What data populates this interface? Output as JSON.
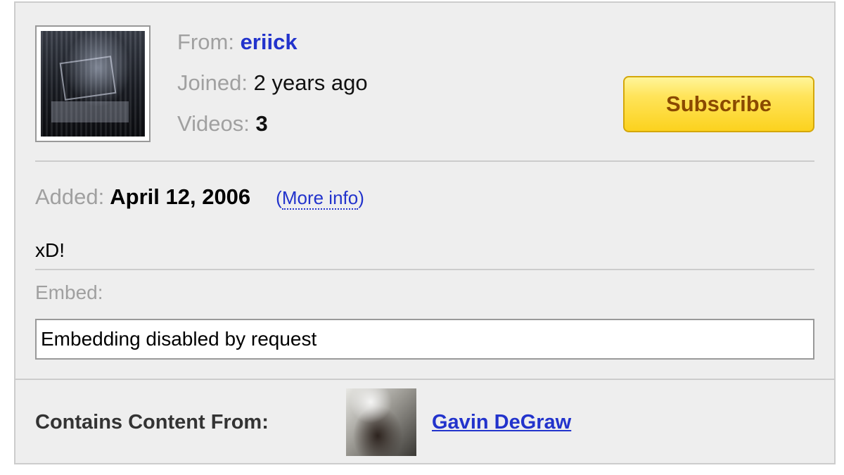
{
  "user": {
    "from_label": "From:",
    "username": "eriick",
    "joined_label": "Joined:",
    "joined_value": "2 years ago",
    "videos_label": "Videos:",
    "videos_count": "3"
  },
  "subscribe_label": "Subscribe",
  "video": {
    "added_label": "Added:",
    "added_date": "April 12, 2006",
    "more_info_open": "(",
    "more_info_label": "More info",
    "more_info_close": ")",
    "description": "xD!"
  },
  "embed": {
    "label": "Embed:",
    "value": "Embedding disabled by request"
  },
  "contains": {
    "label": "Contains Content From:",
    "artist": "Gavin DeGraw"
  },
  "colors": {
    "link": "#2233cc",
    "subscribe_bg": "#fcd21e",
    "subscribe_text": "#8a4a00",
    "panel_bg": "#eeeeee"
  }
}
